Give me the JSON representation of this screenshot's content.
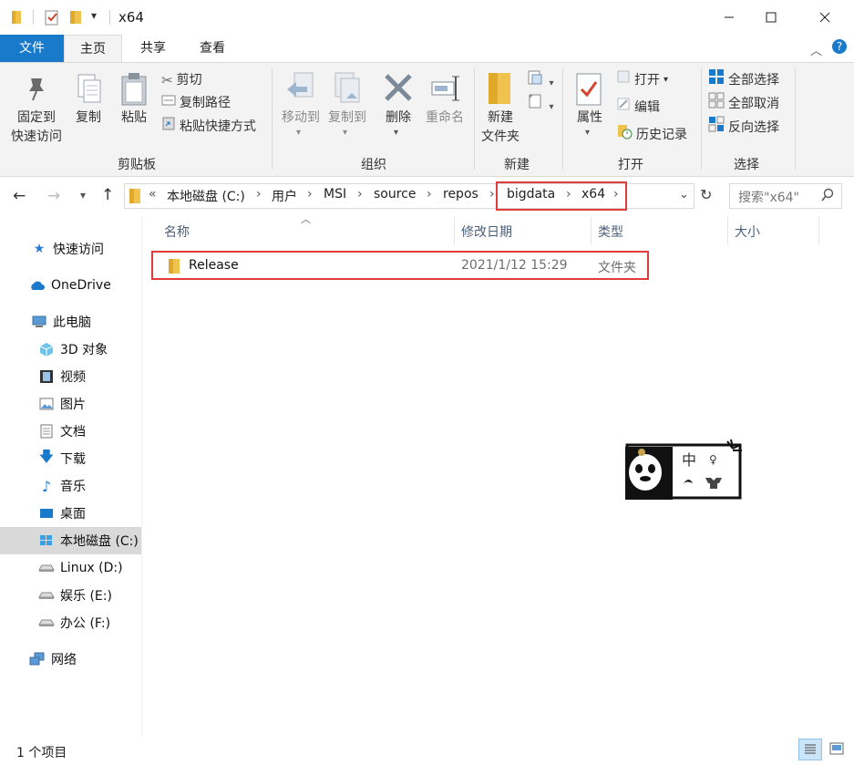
{
  "window": {
    "title": "x64"
  },
  "tabs": {
    "file": "文件",
    "home": "主页",
    "share": "共享",
    "view": "查看"
  },
  "ribbon": {
    "clipboard": {
      "label": "剪贴板",
      "pin": "固定到\n快速访问",
      "pin_line1": "固定到",
      "pin_line2": "快速访问",
      "copy": "复制",
      "paste": "粘贴",
      "cut": "剪切",
      "copy_path": "复制路径",
      "paste_shortcut": "粘贴快捷方式"
    },
    "organize": {
      "label": "组织",
      "move_to": "移动到",
      "copy_to": "复制到",
      "delete": "删除",
      "rename": "重命名"
    },
    "new": {
      "label": "新建",
      "new_folder_line1": "新建",
      "new_folder_line2": "文件夹"
    },
    "open": {
      "label": "打开",
      "properties": "属性",
      "open": "打开",
      "edit": "编辑",
      "history": "历史记录"
    },
    "select": {
      "label": "选择",
      "select_all": "全部选择",
      "select_none": "全部取消",
      "invert": "反向选择"
    }
  },
  "address": {
    "overflow": "«",
    "crumbs": [
      "本地磁盘 (C:)",
      "用户",
      "MSI",
      "source",
      "repos",
      "bigdata",
      "x64"
    ],
    "search_placeholder": "搜索\"x64\""
  },
  "columns": {
    "name": "名称",
    "date": "修改日期",
    "type": "类型",
    "size": "大小"
  },
  "files": [
    {
      "name": "Release",
      "date": "2021/1/12 15:29",
      "type": "文件夹"
    }
  ],
  "nav": {
    "quick_access": "快速访问",
    "onedrive": "OneDrive",
    "this_pc": "此电脑",
    "objects3d": "3D 对象",
    "videos": "视频",
    "pictures": "图片",
    "documents": "文档",
    "downloads": "下载",
    "music": "音乐",
    "desktop": "桌面",
    "drive_c": "本地磁盘 (C:)",
    "drive_d": "Linux (D:)",
    "drive_e": "娱乐 (E:)",
    "drive_f": "办公 (F:)",
    "network": "网络"
  },
  "sticker": {
    "glyph_top": "中",
    "glyph_side": "♀"
  },
  "status": {
    "count": "1 个项目"
  },
  "colors": {
    "accent": "#1979ca",
    "folder": "#f0c34e",
    "highlight_red": "#e03c3c",
    "header_text": "#4c607a"
  }
}
